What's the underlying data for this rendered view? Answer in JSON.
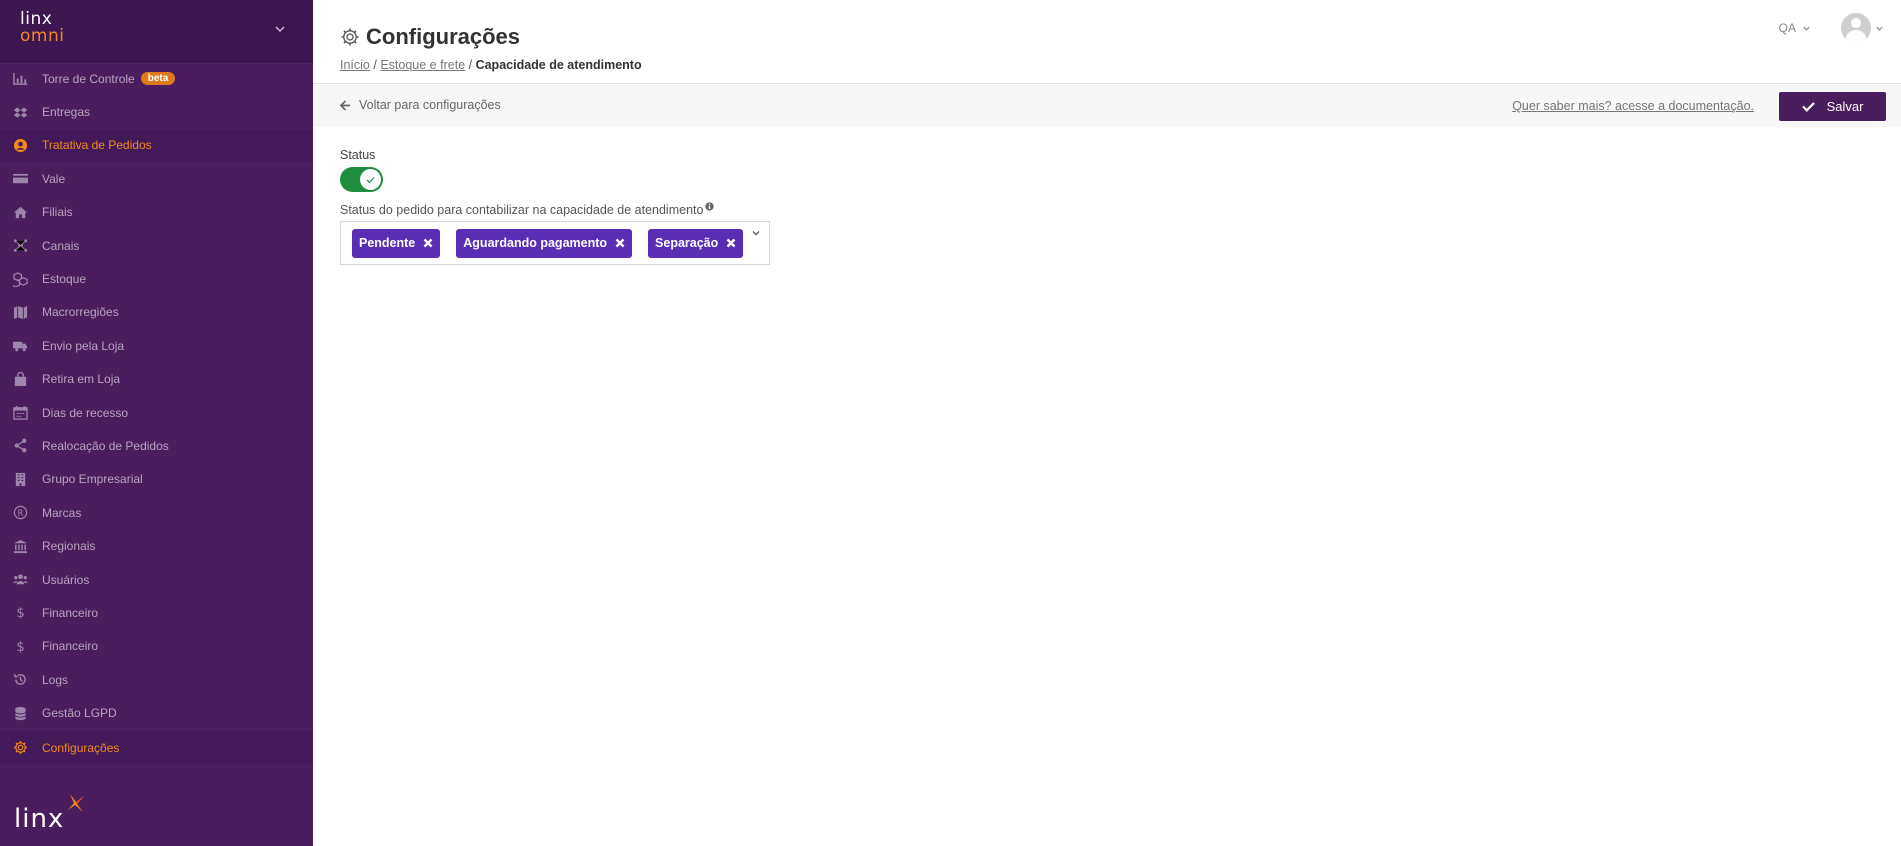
{
  "sidebar": {
    "logo_line1": "linx",
    "logo_line2": "omni",
    "items": [
      {
        "label": "Torre de Controle",
        "icon": "bar-chart-icon",
        "badge": "beta"
      },
      {
        "label": "Entregas",
        "icon": "dropbox-icon"
      },
      {
        "label": "Tratativa de Pedidos",
        "icon": "user-circle-icon",
        "active": true
      },
      {
        "label": "Vale",
        "icon": "credit-card-icon"
      },
      {
        "label": "Filiais",
        "icon": "home-icon"
      },
      {
        "label": "Canais",
        "icon": "network-icon"
      },
      {
        "label": "Estoque",
        "icon": "cubes-icon"
      },
      {
        "label": "Macrorregiões",
        "icon": "map-icon"
      },
      {
        "label": "Envio pela Loja",
        "icon": "truck-icon"
      },
      {
        "label": "Retira em Loja",
        "icon": "shopping-bag-icon"
      },
      {
        "label": "Dias de recesso",
        "icon": "calendar-icon"
      },
      {
        "label": "Realocação de Pedidos",
        "icon": "share-icon"
      },
      {
        "label": "Grupo Empresarial",
        "icon": "building-icon"
      },
      {
        "label": "Marcas",
        "icon": "registered-icon"
      },
      {
        "label": "Regionais",
        "icon": "bank-icon"
      },
      {
        "label": "Usuários",
        "icon": "users-icon"
      },
      {
        "label": "Financeiro",
        "icon": "dollar-icon"
      },
      {
        "label": "Financeiro",
        "icon": "dollar-icon"
      },
      {
        "label": "Logs",
        "icon": "history-icon"
      },
      {
        "label": "Gestão LGPD",
        "icon": "database-icon"
      },
      {
        "label": "Configurações",
        "icon": "gear-icon",
        "active": true
      }
    ],
    "footer_logo": "linx"
  },
  "header": {
    "title": "Configurações",
    "breadcrumb": {
      "home": "Início",
      "sep1": "/",
      "section": "Estoque e frete",
      "sep2": "/",
      "current": "Capacidade de atendimento"
    },
    "user_menu_label": "QA"
  },
  "actionbar": {
    "back_label": "Voltar para configurações",
    "doc_link": "Quer saber mais? acesse a documentação.",
    "save_label": "Salvar"
  },
  "form": {
    "status_label": "Status",
    "status_enabled": true,
    "order_status_label": "Status do pedido para contabilizar na capacidade de atendimento",
    "selected_statuses": [
      "Pendente",
      "Aguardando pagamento",
      "Separação"
    ]
  },
  "colors": {
    "sidebar_bg": "#4a1d5e",
    "accent_orange": "#f28a1b",
    "tag_purple": "#5a2db5",
    "toggle_green": "#1e8e3e",
    "save_button": "#4a1d5e"
  }
}
